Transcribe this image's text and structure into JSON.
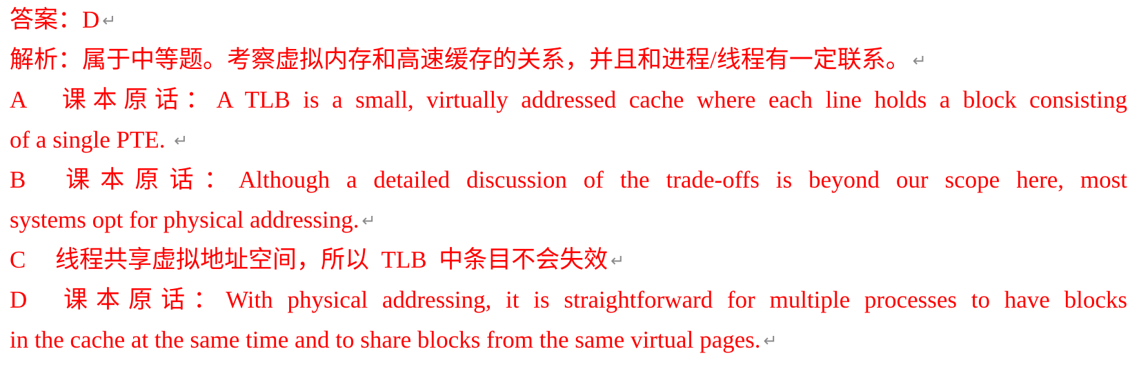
{
  "answer": {
    "prefix": "答案：",
    "value": "D"
  },
  "analysis": {
    "text": "解析：属于中等题。考察虚拟内存和高速缓存的关系，并且和进程/线程有一定联系。"
  },
  "options": [
    {
      "label": "A",
      "lines": [
        "课本原话：A TLB is a small, virtually addressed cache where each line holds a block consisting",
        "of a single PTE. "
      ]
    },
    {
      "label": "B",
      "lines": [
        "课本原话：Although a detailed discussion of the trade-offs is beyond our scope here, most",
        "systems opt for physical addressing."
      ]
    },
    {
      "label": "C",
      "lines": [
        "线程共享虚拟地址空间，所以  TLB  中条目不会失效"
      ]
    },
    {
      "label": "D",
      "lines": [
        "课本原话：With physical addressing, it is straightforward for multiple processes to have blocks",
        "in the cache at the same time and to share blocks from the same virtual pages."
      ]
    }
  ],
  "paragraph_mark": "↵",
  "colors": {
    "text": "#ff0000",
    "paragraph_mark": "#8a8a8a",
    "background": "#ffffff"
  }
}
